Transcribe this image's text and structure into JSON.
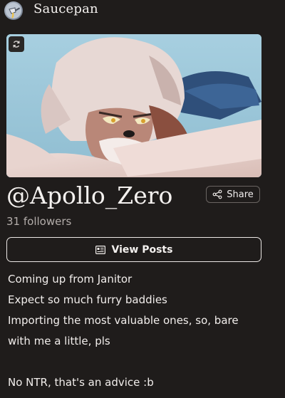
{
  "header": {
    "logo_icon": "saucepan-logo",
    "app_title": "Saucepan"
  },
  "banner": {
    "refresh_icon": "refresh-icon",
    "image_description_icon": "artwork-banner"
  },
  "profile": {
    "username": "@Apollo_Zero",
    "share_label": "Share",
    "share_icon": "share-icon",
    "followers": "31 followers"
  },
  "actions": {
    "view_posts_label": "View Posts",
    "view_posts_icon": "posts-icon"
  },
  "bio": {
    "lines": [
      "Coming up from Janitor",
      "Expect so much furry baddies",
      "Importing the most valuable ones, so, bare",
      "with me a little, pls",
      "",
      "No NTR, that's an advice :b"
    ]
  },
  "colors": {
    "background": "#1f1c1b",
    "text": "#f2f0ef",
    "muted": "#b3adaa",
    "border": "#ece8e6"
  }
}
